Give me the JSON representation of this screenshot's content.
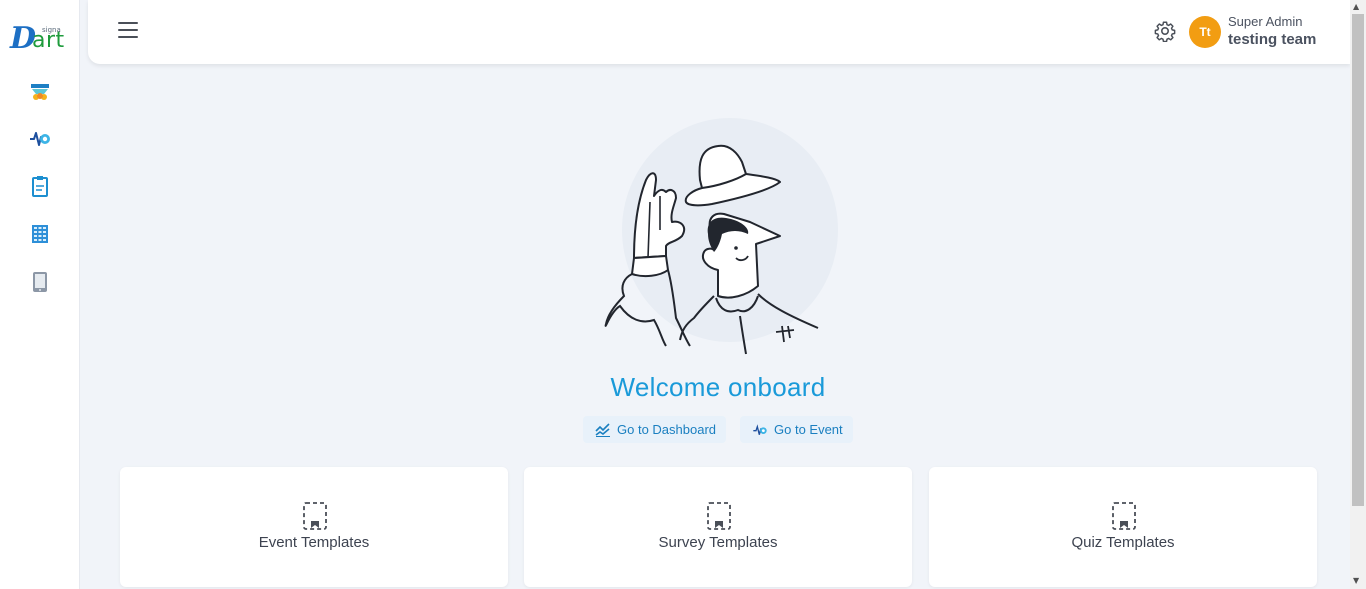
{
  "app": {
    "logo_main": "Dart",
    "logo_sub": "signa",
    "logo_d": "D",
    "logo_art": "art"
  },
  "sidebar": {
    "items": [
      {
        "icon": "templates-icon"
      },
      {
        "icon": "event-pulse-icon"
      },
      {
        "icon": "clipboard-icon"
      },
      {
        "icon": "building-icon"
      },
      {
        "icon": "tablet-icon"
      }
    ]
  },
  "header": {
    "user_initials": "Tt",
    "user_role": "Super Admin",
    "user_team": "testing team"
  },
  "main": {
    "welcome": "Welcome onboard",
    "buttons": {
      "dashboard": "Go to Dashboard",
      "event": "Go to Event"
    },
    "cards": [
      {
        "label": "Event Templates",
        "icon": "template-icon"
      },
      {
        "label": "Survey Templates",
        "icon": "template-icon"
      },
      {
        "label": "Quiz Templates",
        "icon": "template-icon"
      }
    ]
  },
  "colors": {
    "accent": "#1a9ad9",
    "avatar": "#f29d12",
    "background": "#f1f4f9"
  }
}
